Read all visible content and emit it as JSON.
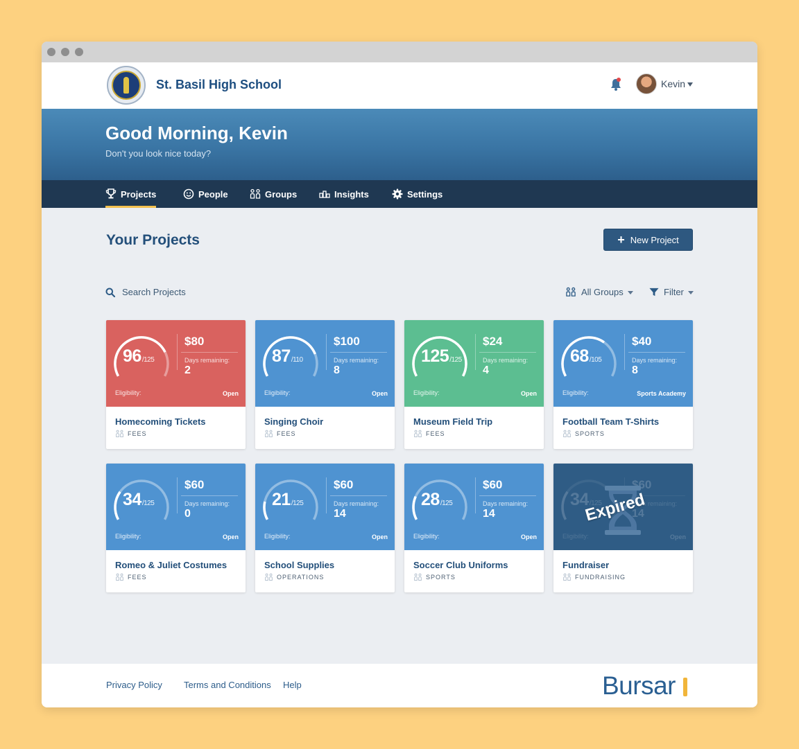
{
  "header": {
    "school_name": "St. Basil High School",
    "user_name": "Kevin"
  },
  "hero": {
    "greeting": "Good Morning, Kevin",
    "subtitle": "Don't you look nice today?"
  },
  "nav": [
    {
      "label": "Projects",
      "icon": "trophy-icon",
      "active": true
    },
    {
      "label": "People",
      "icon": "smiley-icon",
      "active": false
    },
    {
      "label": "Groups",
      "icon": "groups-icon",
      "active": false
    },
    {
      "label": "Insights",
      "icon": "bar-chart-icon",
      "active": false
    },
    {
      "label": "Settings",
      "icon": "gear-icon",
      "active": false
    }
  ],
  "main": {
    "title": "Your Projects",
    "new_project_label": "New Project",
    "search_placeholder": "Search Projects",
    "all_groups_label": "All Groups",
    "filter_label": "Filter"
  },
  "labels": {
    "days_remaining": "Days remaining:",
    "eligibility": "Eligibility:",
    "expired": "Expired"
  },
  "colors": {
    "red": "#d9625f",
    "blue": "#4f93d1",
    "green": "#5cbe91",
    "expired": "#2f5c85"
  },
  "projects": [
    {
      "name": "Homecoming Tickets",
      "category": "FEES",
      "score": "96",
      "max": "/125",
      "amount": "$80",
      "days": "2",
      "status": "Open",
      "color": "red",
      "fill": 0.77
    },
    {
      "name": "Singing Choir",
      "category": "FEES",
      "score": "87",
      "max": "/110",
      "amount": "$100",
      "days": "8",
      "status": "Open",
      "color": "blue",
      "fill": 0.79
    },
    {
      "name": "Museum Field Trip",
      "category": "FEES",
      "score": "125",
      "max": "/125",
      "amount": "$24",
      "days": "4",
      "status": "Open",
      "color": "green",
      "fill": 1.0
    },
    {
      "name": "Football Team T-Shirts",
      "category": "SPORTS",
      "score": "68",
      "max": "/105",
      "amount": "$40",
      "days": "8",
      "status": "Sports Academy",
      "color": "blue",
      "fill": 0.65
    },
    {
      "name": "Romeo & Juliet Costumes",
      "category": "FEES",
      "score": "34",
      "max": "/125",
      "amount": "$60",
      "days": "0",
      "status": "Open",
      "color": "blue",
      "fill": 0.27
    },
    {
      "name": "School Supplies",
      "category": "OPERATIONS",
      "score": "21",
      "max": "/125",
      "amount": "$60",
      "days": "14",
      "status": "Open",
      "color": "blue",
      "fill": 0.17
    },
    {
      "name": "Soccer Club Uniforms",
      "category": "SPORTS",
      "score": "28",
      "max": "/125",
      "amount": "$60",
      "days": "14",
      "status": "Open",
      "color": "blue",
      "fill": 0.22
    },
    {
      "name": "Fundraiser",
      "category": "FUNDRAISING",
      "score": "34",
      "max": "/125",
      "amount": "$60",
      "days": "14",
      "status": "Open",
      "color": "expired",
      "fill": 0.27,
      "expired": true
    }
  ],
  "footer": {
    "links": [
      "Privacy Policy",
      "Terms and Conditions",
      "Help"
    ],
    "brand": "Bursar"
  }
}
